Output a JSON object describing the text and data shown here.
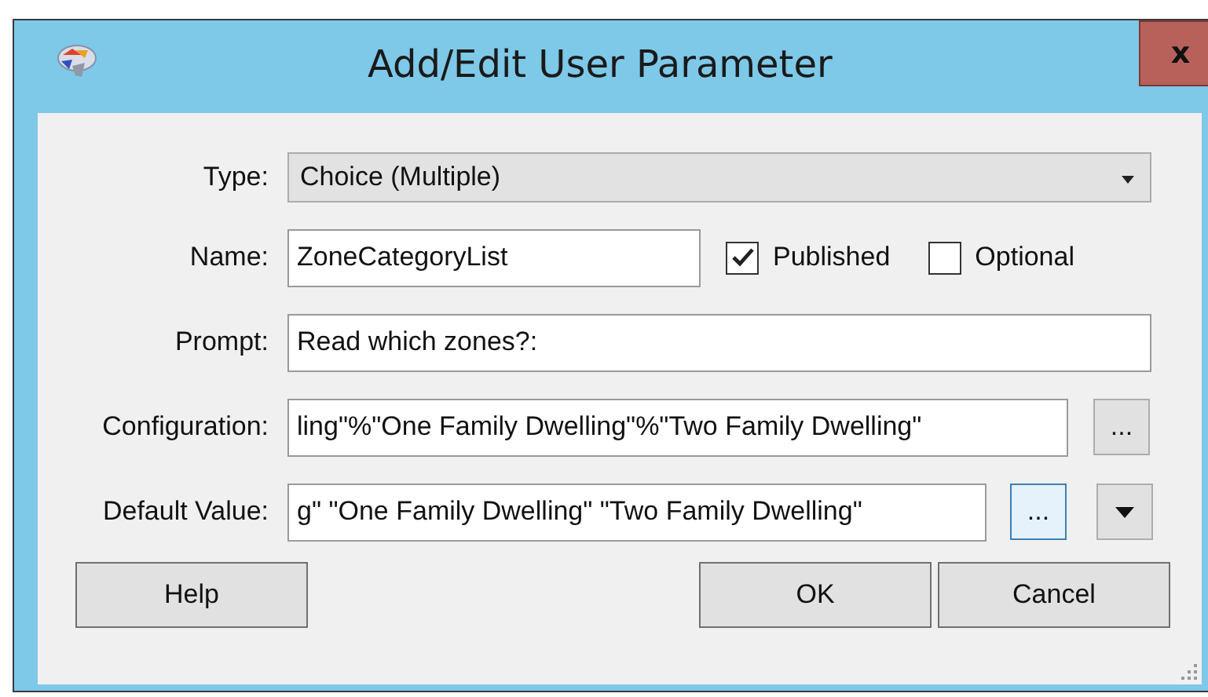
{
  "window": {
    "title": "Add/Edit User Parameter",
    "close": "x"
  },
  "fields": [
    {
      "kind": "dropdown",
      "label": "Type:",
      "value": "Choice (Multiple)"
    },
    {
      "kind": "name",
      "label": "Name:",
      "value": "ZoneCategoryList",
      "checkboxes": [
        {
          "label": "Published",
          "checked": true
        },
        {
          "label": "Optional",
          "checked": false
        }
      ]
    },
    {
      "kind": "text",
      "label": "Prompt:",
      "value": "Read which zones?:"
    },
    {
      "kind": "browse",
      "label": "Configuration:",
      "value": "ling\"%\"One Family Dwelling\"%\"Two Family Dwelling\"",
      "button": "..."
    },
    {
      "kind": "browse_menu",
      "label": "Default Value:",
      "value": "g\" \"One Family Dwelling\" \"Two Family Dwelling\"",
      "button": "..."
    }
  ],
  "buttons": [
    "Help",
    "OK",
    "Cancel"
  ]
}
